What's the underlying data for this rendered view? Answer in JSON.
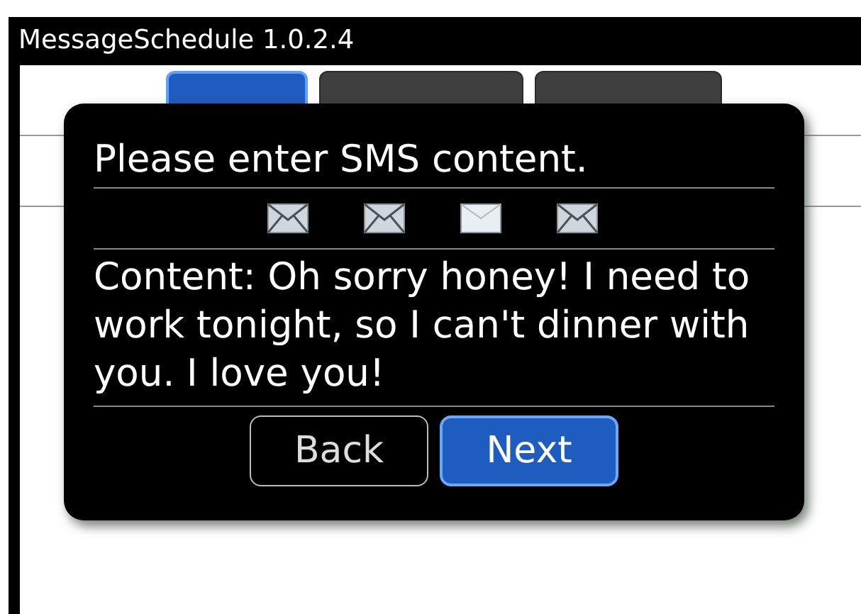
{
  "window": {
    "title": "MessageSchedule 1.0.2.4"
  },
  "tabs": [
    {
      "selected": true
    },
    {
      "selected": false
    },
    {
      "selected": false
    }
  ],
  "dialog": {
    "title": "Please enter SMS content.",
    "message_icons": [
      {
        "selected": false
      },
      {
        "selected": false
      },
      {
        "selected": true
      },
      {
        "selected": false
      }
    ],
    "content": "Content: Oh sorry honey! I need to work tonight, so I can't dinner with you. I love you!",
    "buttons": [
      {
        "label": "Back",
        "selected": false
      },
      {
        "label": "Next",
        "selected": true
      }
    ]
  }
}
